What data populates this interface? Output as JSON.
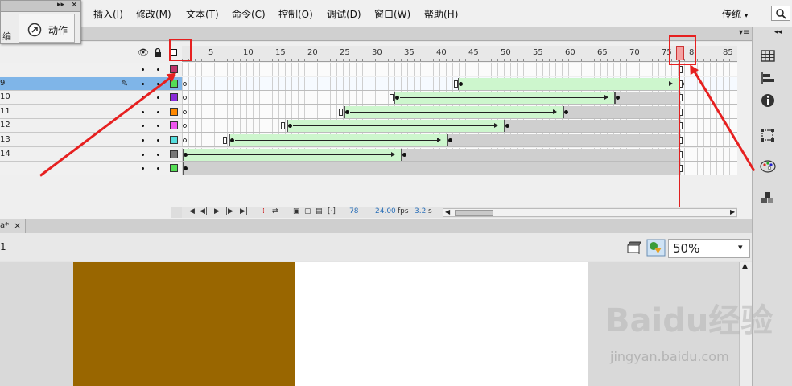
{
  "menu": {
    "edit_partial": "编辑",
    "items": [
      "插入(I)",
      "修改(M)",
      "文本(T)",
      "命令(C)",
      "控制(O)",
      "调试(D)",
      "窗口(W)",
      "帮助(H)"
    ],
    "workspace": "传统",
    "workspace_arrow": "▾"
  },
  "actions_panel": {
    "label": "动作",
    "panel_tab_partial": "编"
  },
  "timeline": {
    "ruler_labels": [
      "1",
      "5",
      "10",
      "15",
      "20",
      "25",
      "30",
      "35",
      "40",
      "45",
      "50",
      "55",
      "60",
      "65",
      "70",
      "75",
      "8",
      "85"
    ],
    "layers": [
      {
        "name": "",
        "color": "#c0336a",
        "selected": false
      },
      {
        "name": "9",
        "color": "#55dd55",
        "selected": true
      },
      {
        "name": "10",
        "color": "#8a2bd8",
        "selected": false
      },
      {
        "name": "11",
        "color": "#ff8800",
        "selected": false
      },
      {
        "name": "12",
        "color": "#ee55ee",
        "selected": false
      },
      {
        "name": "13",
        "color": "#55dddd",
        "selected": false
      },
      {
        "name": "14",
        "color": "#777777",
        "selected": false
      },
      {
        "name": "",
        "color": "#55dd55",
        "selected": false
      }
    ],
    "current_frame": "78",
    "fps": "24.00",
    "fps_unit": "fps",
    "time": "3.2",
    "time_unit": "s"
  },
  "document": {
    "tab_label": "a*",
    "tab_close": "×",
    "scene_label": "1",
    "zoom": "50%",
    "zoom_arrow": "▾"
  },
  "watermark": {
    "brand": "Baidu经验",
    "url": "jingyan.baidu.com"
  },
  "colors": {
    "selection": "#7fb5e8",
    "tween": "#cdf6cd",
    "playhead": "#e02020",
    "annotation": "#e62020",
    "stage_rect": "#996600"
  }
}
